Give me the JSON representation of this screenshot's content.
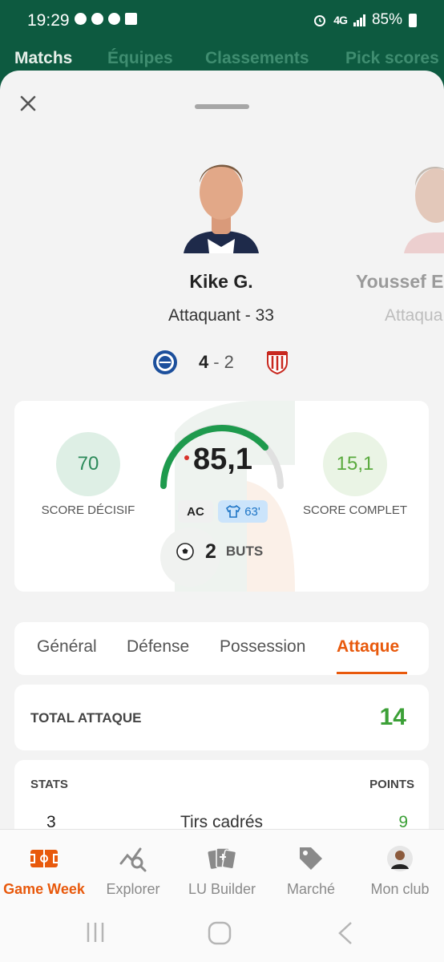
{
  "status_bar": {
    "time": "19:29",
    "network": "4G",
    "battery": "85%"
  },
  "top_nav": {
    "tabs": [
      {
        "label": "Matchs",
        "active": true
      },
      {
        "label": "Équipes",
        "active": false
      },
      {
        "label": "Classements",
        "active": false
      },
      {
        "label": "Pick scores",
        "active": false
      }
    ]
  },
  "player": {
    "name": "Kike G.",
    "position_age": "Attaquant - 33",
    "match": {
      "home_score": "4",
      "separator": "-",
      "away_score": "2"
    }
  },
  "next_player": {
    "name": "Youssef E",
    "position": "Attaqua"
  },
  "score_card": {
    "decisive_score": "70",
    "decisive_label": "SCORE DÉCISIF",
    "main_score": "85,1",
    "complete_score": "15,1",
    "complete_label": "SCORE COMPLET",
    "role_badge": "AC",
    "minutes_badge": "63'",
    "goals_value": "2",
    "goals_label": "BUTS"
  },
  "stat_tabs": [
    {
      "label": "Général",
      "active": false
    },
    {
      "label": "Défense",
      "active": false
    },
    {
      "label": "Possession",
      "active": false
    },
    {
      "label": "Attaque",
      "active": true
    }
  ],
  "total": {
    "label": "TOTAL ATTAQUE",
    "value": "14"
  },
  "stats_table": {
    "header_stats": "STATS",
    "header_points": "POINTS",
    "rows": [
      {
        "value": "3",
        "name": "Tirs cadrés",
        "points": "9"
      }
    ]
  },
  "bottom_nav": {
    "items": [
      {
        "label": "Game Week",
        "icon": "pitch-icon",
        "active": true
      },
      {
        "label": "Explorer",
        "icon": "chart-search-icon",
        "active": false
      },
      {
        "label": "LU Builder",
        "icon": "cards-icon",
        "active": false
      },
      {
        "label": "Marché",
        "icon": "tag-icon",
        "active": false
      },
      {
        "label": "Mon club",
        "icon": "avatar-icon",
        "active": false
      }
    ]
  },
  "colors": {
    "brand_green": "#0d5a40",
    "accent_orange": "#e8590c",
    "points_green": "#3ca037"
  }
}
